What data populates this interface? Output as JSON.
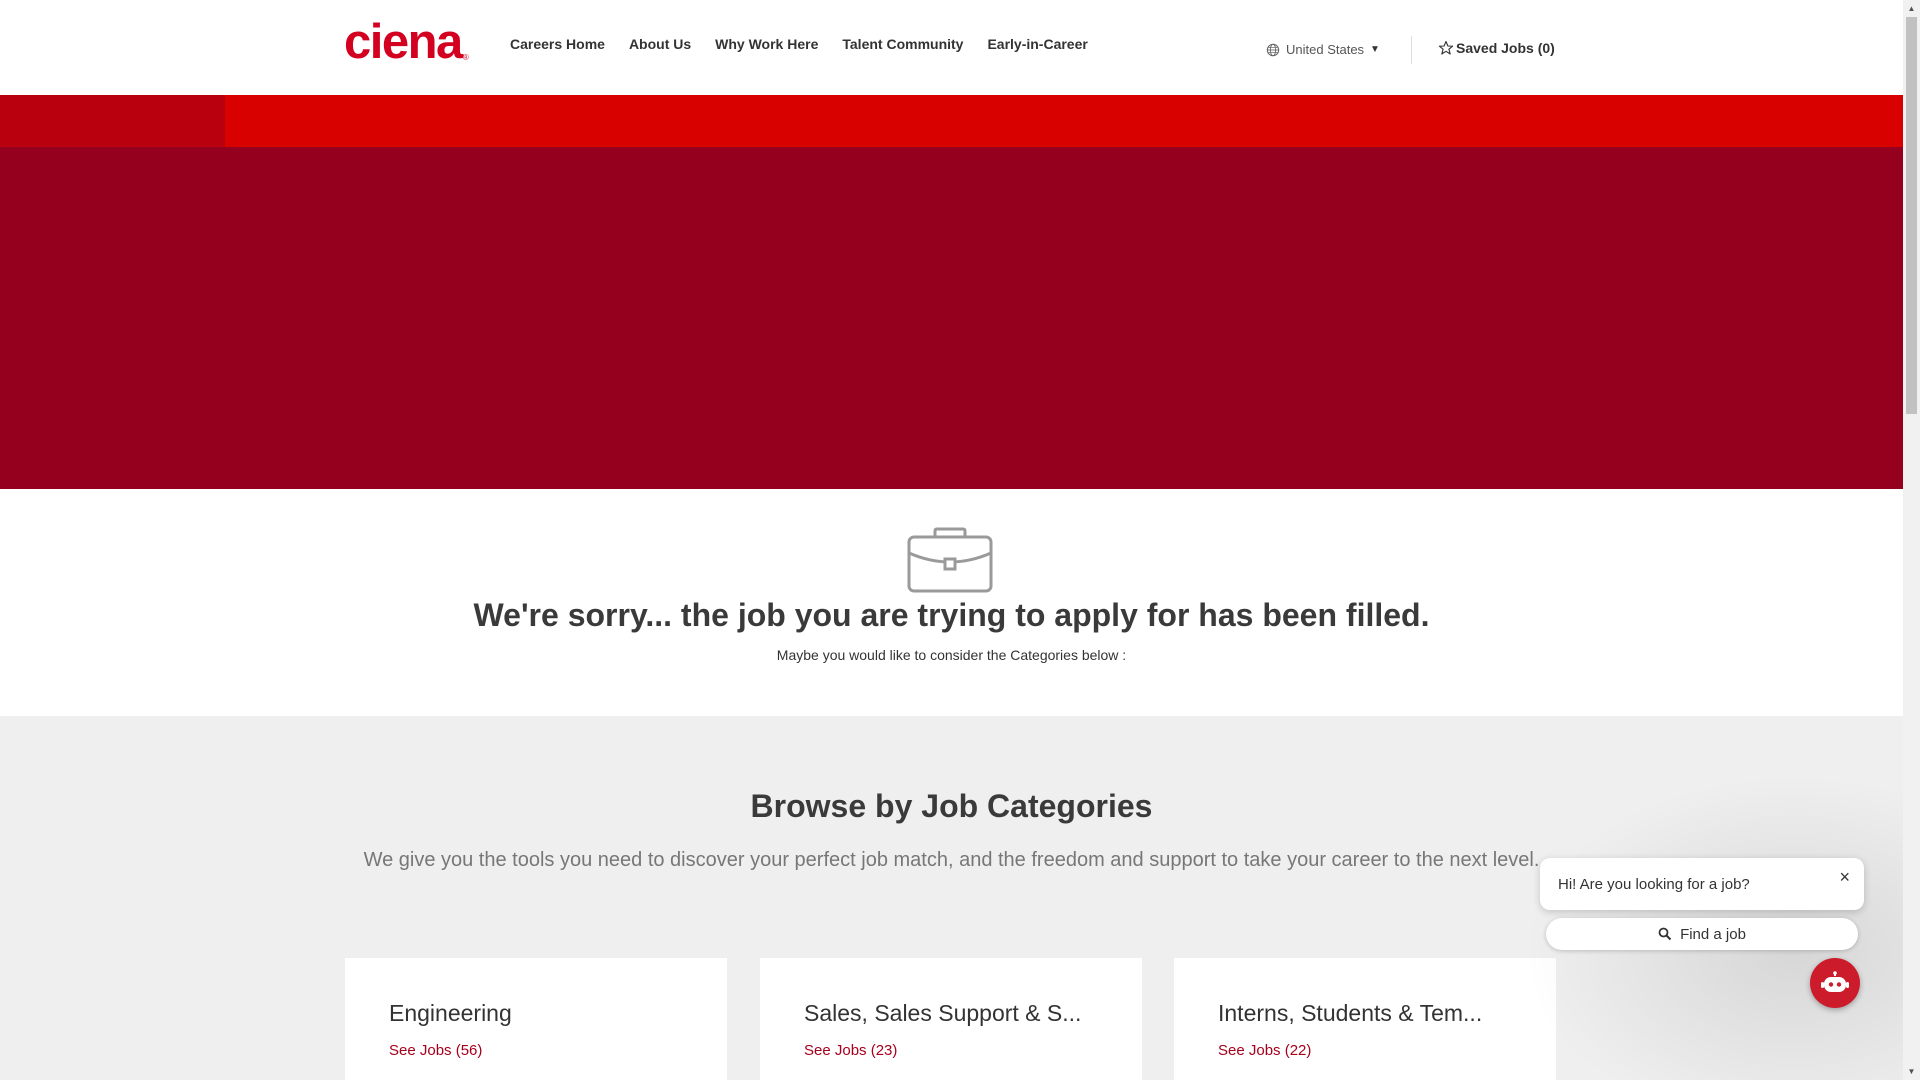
{
  "header": {
    "logo_text": "ciena",
    "logo_mark": "®",
    "nav": [
      {
        "label": "Careers Home"
      },
      {
        "label": "About Us"
      },
      {
        "label": "Why Work Here"
      },
      {
        "label": "Talent Community"
      },
      {
        "label": "Early-in-Career"
      }
    ],
    "country": {
      "label": "United States",
      "icon": "globe-icon",
      "caret": "▼"
    },
    "saved_jobs": {
      "label": "Saved Jobs (0)",
      "icon": "star-icon"
    }
  },
  "colors": {
    "brand_red": "#d3001f",
    "banner_red": "#d90000",
    "hero_maroon": "#95001e",
    "link_red": "#a6001c"
  },
  "sorry": {
    "icon": "briefcase-icon",
    "title": "We're sorry... the job you are trying to apply for has been filled.",
    "subtitle": "Maybe you would like to consider the Categories below :"
  },
  "browse": {
    "title": "Browse by Job Categories",
    "description": "We give you the tools you need to discover your perfect job match, and the freedom and support to take your career to the next level.",
    "categories": [
      {
        "title": "Engineering",
        "link": "See Jobs (56)"
      },
      {
        "title": "Sales, Sales Support & S...",
        "link": "See Jobs (23)"
      },
      {
        "title": "Interns, Students & Tem...",
        "link": "See Jobs (22)"
      }
    ]
  },
  "chat": {
    "greeting": "Hi! Are you looking for a job?",
    "close": "×",
    "find_label": "Find a job",
    "bot_icon": "chatbot-icon"
  },
  "scrollbar": {
    "up": "▲",
    "down": "▼"
  }
}
